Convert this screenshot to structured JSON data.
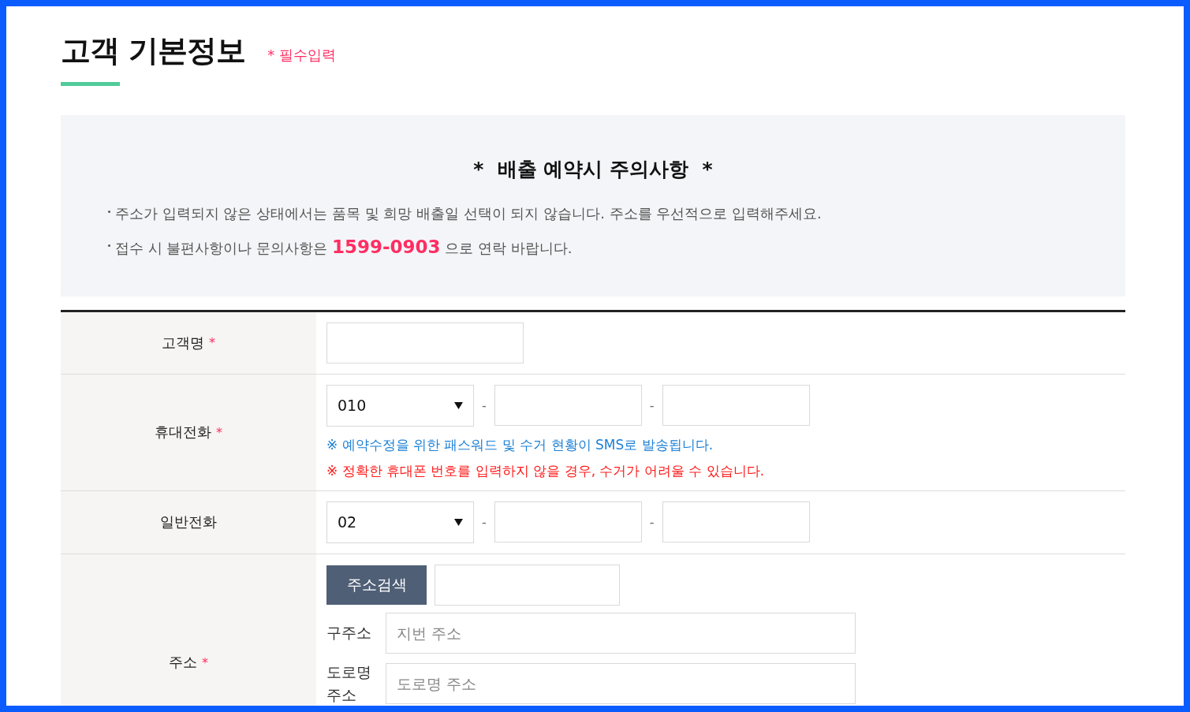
{
  "header": {
    "title": "고객 기본정보",
    "required_note": "* 필수입력"
  },
  "notice": {
    "title": "*  배출 예약시 주의사항  *",
    "lines": [
      "주소가 입력되지 않은 상태에서는 품목 및 희망 배출일 선택이 되지 않습니다. 주소를 우선적으로 입력해주세요.",
      "접수 시 불편사항이나 문의사항은 **1599-0903** 으로 연락 바랍니다."
    ]
  },
  "rows": [
    {
      "kind": "text",
      "label": "고객명",
      "required_mark": "*"
    },
    {
      "kind": "phone",
      "label": "휴대전화",
      "required_mark": "*",
      "prefix": "010",
      "separators": [
        "-",
        "-"
      ],
      "notes": [
        {
          "text": "※ 예약수정을 위한 패스워드 및 수거 현황이 SMS로 발송됩니다.",
          "color": "#1a7fd6"
        },
        {
          "text": "※ 정확한 휴대폰 번호를 입력하지 않을 경우, 수거가 어려울 수 있습니다.",
          "color": "#ff1a1a"
        }
      ]
    },
    {
      "kind": "phone",
      "label": "일반전화",
      "prefix": "02",
      "separators": [
        "-",
        "-"
      ]
    },
    {
      "kind": "address",
      "label": "주소",
      "required_mark": "*",
      "search_button": "주소검색",
      "fields": [
        {
          "label": "구주소",
          "placeholder": "지번 주소"
        },
        {
          "label": "도로명 주소",
          "placeholder": "도로명 주소"
        }
      ]
    }
  ]
}
